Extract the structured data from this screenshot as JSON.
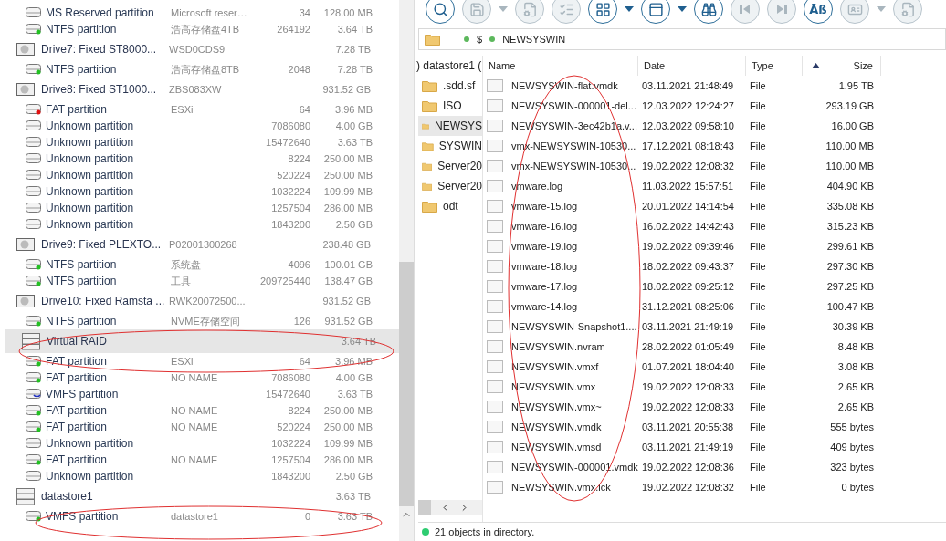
{
  "disk_tree": {
    "rows": [
      {
        "kind": "plain",
        "name": "MS Reserved partition",
        "label": "Microsoft reser…",
        "start": "34",
        "size": "128.00 MB",
        "selected": false
      },
      {
        "kind": "ok",
        "name": "NTFS partition",
        "label": "浩高存储盘4TB",
        "start": "264192",
        "size": "3.64 TB",
        "selected": false
      },
      {
        "kind": "drive",
        "name": "Drive7: Fixed ST8000...",
        "label": "WSD0CDS9",
        "size": "7.28 TB",
        "selected": false
      },
      {
        "kind": "ok",
        "name": "NTFS partition",
        "label": "浩高存储盘8TB",
        "start": "2048",
        "size": "7.28 TB",
        "selected": false
      },
      {
        "kind": "drive",
        "name": "Drive8: Fixed ST1000...",
        "label": "ZBS083XW",
        "size": "931.52 GB",
        "selected": false
      },
      {
        "kind": "error",
        "name": "FAT partition",
        "label": "ESXi",
        "start": "64",
        "size": "3.96 MB",
        "selected": false
      },
      {
        "kind": "plain",
        "name": "Unknown partition",
        "start": "7086080",
        "size": "4.00 GB",
        "selected": false
      },
      {
        "kind": "plain",
        "name": "Unknown partition",
        "start": "15472640",
        "size": "3.63 TB",
        "selected": false
      },
      {
        "kind": "plain",
        "name": "Unknown partition",
        "start": "8224",
        "size": "250.00 MB",
        "selected": false
      },
      {
        "kind": "plain",
        "name": "Unknown partition",
        "start": "520224",
        "size": "250.00 MB",
        "selected": false
      },
      {
        "kind": "plain",
        "name": "Unknown partition",
        "start": "1032224",
        "size": "109.99 MB",
        "selected": false
      },
      {
        "kind": "plain",
        "name": "Unknown partition",
        "start": "1257504",
        "size": "286.00 MB",
        "selected": false
      },
      {
        "kind": "plain",
        "name": "Unknown partition",
        "start": "1843200",
        "size": "2.50 GB",
        "selected": false
      },
      {
        "kind": "drive",
        "name": "Drive9: Fixed PLEXTO...",
        "label": "P02001300268",
        "size": "238.48 GB",
        "selected": false
      },
      {
        "kind": "ok",
        "name": "NTFS partition",
        "label": "系统盘",
        "start": "4096",
        "size": "100.01 GB",
        "selected": false
      },
      {
        "kind": "ok",
        "name": "NTFS partition",
        "label": "工具",
        "start": "209725440",
        "size": "138.47 GB",
        "selected": false
      },
      {
        "kind": "drive",
        "name": "Drive10: Fixed Ramsta ...",
        "label": "RWK20072500...",
        "size": "931.52 GB",
        "selected": false
      },
      {
        "kind": "ok",
        "name": "NTFS partition",
        "label": "NVME存储空间",
        "start": "126",
        "size": "931.52 GB",
        "selected": false
      },
      {
        "kind": "raid",
        "name": "Virtual RAID",
        "size": "3.64 TB",
        "selected": true
      },
      {
        "kind": "ok",
        "name": "FAT partition",
        "label": "ESXi",
        "start": "64",
        "size": "3.96 MB",
        "selected": false
      },
      {
        "kind": "ok",
        "name": "FAT partition",
        "label": "NO NAME",
        "start": "7086080",
        "size": "4.00 GB",
        "selected": false
      },
      {
        "kind": "vmfs",
        "name": "VMFS partition",
        "start": "15472640",
        "size": "3.63 TB",
        "selected": false
      },
      {
        "kind": "ok",
        "name": "FAT partition",
        "label": "NO NAME",
        "start": "8224",
        "size": "250.00 MB",
        "selected": false
      },
      {
        "kind": "ok",
        "name": "FAT partition",
        "label": "NO NAME",
        "start": "520224",
        "size": "250.00 MB",
        "selected": false
      },
      {
        "kind": "plain",
        "name": "Unknown partition",
        "start": "1032224",
        "size": "109.99 MB",
        "selected": false
      },
      {
        "kind": "ok",
        "name": "FAT partition",
        "label": "NO NAME",
        "start": "1257504",
        "size": "286.00 MB",
        "selected": false
      },
      {
        "kind": "plain",
        "name": "Unknown partition",
        "start": "1843200",
        "size": "2.50 GB",
        "selected": false
      },
      {
        "kind": "raid",
        "name": "datastore1",
        "size": "3.63 TB",
        "selected": false
      },
      {
        "kind": "ok",
        "name": "VMFS partition",
        "label": "datastore1",
        "start": "0",
        "size": "3.63 TB",
        "selected": false
      }
    ]
  },
  "toolbar": [
    {
      "kind": "zoom",
      "disabled": false,
      "dropdown": false
    },
    {
      "kind": "save",
      "disabled": true,
      "dropdown": true
    },
    {
      "kind": "filegear",
      "disabled": true,
      "dropdown": false
    },
    {
      "kind": "checklist",
      "disabled": true,
      "dropdown": false
    },
    {
      "kind": "grid",
      "disabled": false,
      "dropdown": true
    },
    {
      "kind": "rows",
      "disabled": false,
      "dropdown": true
    },
    {
      "kind": "binoculars",
      "disabled": false,
      "dropdown": false
    },
    {
      "kind": "prev",
      "disabled": true,
      "dropdown": false
    },
    {
      "kind": "next",
      "disabled": true,
      "dropdown": false
    },
    {
      "kind": "text",
      "glyph": "Āß",
      "disabled": false,
      "dropdown": false
    },
    {
      "kind": "card",
      "disabled": true,
      "dropdown": true
    },
    {
      "kind": "filegear",
      "disabled": true,
      "dropdown": false
    }
  ],
  "path": [
    "$",
    "NEWSYSWIN"
  ],
  "folders": [
    {
      "name": ".sdd.sf",
      "selected": false
    },
    {
      "name": "ISO",
      "selected": false
    },
    {
      "name": "NEWSYS",
      "selected": true
    },
    {
      "name": "SYSWIN",
      "selected": false
    },
    {
      "name": "Server20",
      "selected": false
    },
    {
      "name": "Server20",
      "selected": false
    },
    {
      "name": "odt",
      "selected": false
    }
  ],
  "folder_root": ") datastore1 (",
  "table": {
    "columns": [
      {
        "label": "Name",
        "sorted": false
      },
      {
        "label": "Date",
        "sorted": false
      },
      {
        "label": "Type",
        "sorted": false
      },
      {
        "label": "Size",
        "sorted": true
      }
    ],
    "rows": [
      [
        "NEWSYSWIN-flat.vmdk",
        "03.11.2021 21:48:49",
        "File",
        "1.95 TB"
      ],
      [
        "NEWSYSWIN-000001-del...",
        "12.03.2022 12:24:27",
        "File",
        "293.19 GB"
      ],
      [
        "NEWSYSWIN-3ec42b1a.v...",
        "12.03.2022 09:58:10",
        "File",
        "16.00 GB"
      ],
      [
        "vmx-NEWSYSWIN-10530...",
        "17.12.2021 08:18:43",
        "File",
        "110.00 MB"
      ],
      [
        "vmx-NEWSYSWIN-10530...",
        "19.02.2022 12:08:32",
        "File",
        "110.00 MB"
      ],
      [
        "vmware.log",
        "11.03.2022 15:57:51",
        "File",
        "404.90 KB"
      ],
      [
        "vmware-15.log",
        "20.01.2022 14:14:54",
        "File",
        "335.08 KB"
      ],
      [
        "vmware-16.log",
        "16.02.2022 14:42:43",
        "File",
        "315.23 KB"
      ],
      [
        "vmware-19.log",
        "19.02.2022 09:39:46",
        "File",
        "299.61 KB"
      ],
      [
        "vmware-18.log",
        "18.02.2022 09:43:37",
        "File",
        "297.30 KB"
      ],
      [
        "vmware-17.log",
        "18.02.2022 09:25:12",
        "File",
        "297.25 KB"
      ],
      [
        "vmware-14.log",
        "31.12.2021 08:25:06",
        "File",
        "100.47 KB"
      ],
      [
        "NEWSYSWIN-Snapshot1....",
        "03.11.2021 21:49:19",
        "File",
        "30.39 KB"
      ],
      [
        "NEWSYSWIN.nvram",
        "28.02.2022 01:05:49",
        "File",
        "8.48 KB"
      ],
      [
        "NEWSYSWIN.vmxf",
        "01.07.2021 18:04:40",
        "File",
        "3.08 KB"
      ],
      [
        "NEWSYSWIN.vmx",
        "19.02.2022 12:08:33",
        "File",
        "2.65 KB"
      ],
      [
        "NEWSYSWIN.vmx~",
        "19.02.2022 12:08:33",
        "File",
        "2.65 KB"
      ],
      [
        "NEWSYSWIN.vmdk",
        "03.11.2021 20:55:38",
        "File",
        "555 bytes"
      ],
      [
        "NEWSYSWIN.vmsd",
        "03.11.2021 21:49:19",
        "File",
        "409 bytes"
      ],
      [
        "NEWSYSWIN-000001.vmdk",
        "19.02.2022 12:08:36",
        "File",
        "323 bytes"
      ],
      [
        "NEWSYSWIN.vmx.lck",
        "19.02.2022 12:08:32",
        "File",
        "0 bytes"
      ]
    ]
  },
  "status_bar": {
    "kind": "ok",
    "text": "21 objects in directory."
  }
}
